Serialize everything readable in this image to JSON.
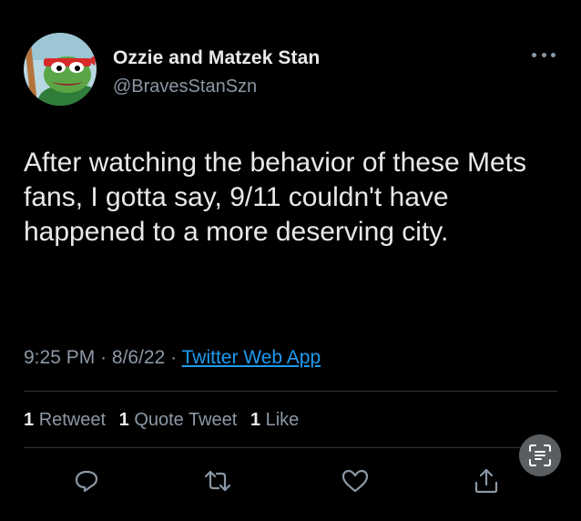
{
  "tweet": {
    "display_name": "Ozzie and Matzek Stan",
    "handle": "@BravesStanSzn",
    "text": "After watching the behavior of these Mets fans, I gotta say, 9/11 couldn't have happened to a more deserving city.",
    "time": "9:25 PM",
    "separator": "·",
    "date": "8/6/22",
    "source": "Twitter Web App"
  },
  "stats": {
    "retweets_count": "1",
    "retweets_label": "Retweet",
    "quote_count": "1",
    "quote_label": "Quote Tweet",
    "likes_count": "1",
    "likes_label": "Like"
  },
  "icons": {
    "avatar": "cartoon-frog-avatar",
    "more": "more-options-icon",
    "reply": "reply-icon",
    "retweet": "retweet-icon",
    "like": "heart-icon",
    "share": "share-icon",
    "scan": "text-scan-icon"
  },
  "colors": {
    "background": "#000000",
    "text": "#e7e9ea",
    "muted": "#8b98a5",
    "link": "#1d9bf0"
  }
}
